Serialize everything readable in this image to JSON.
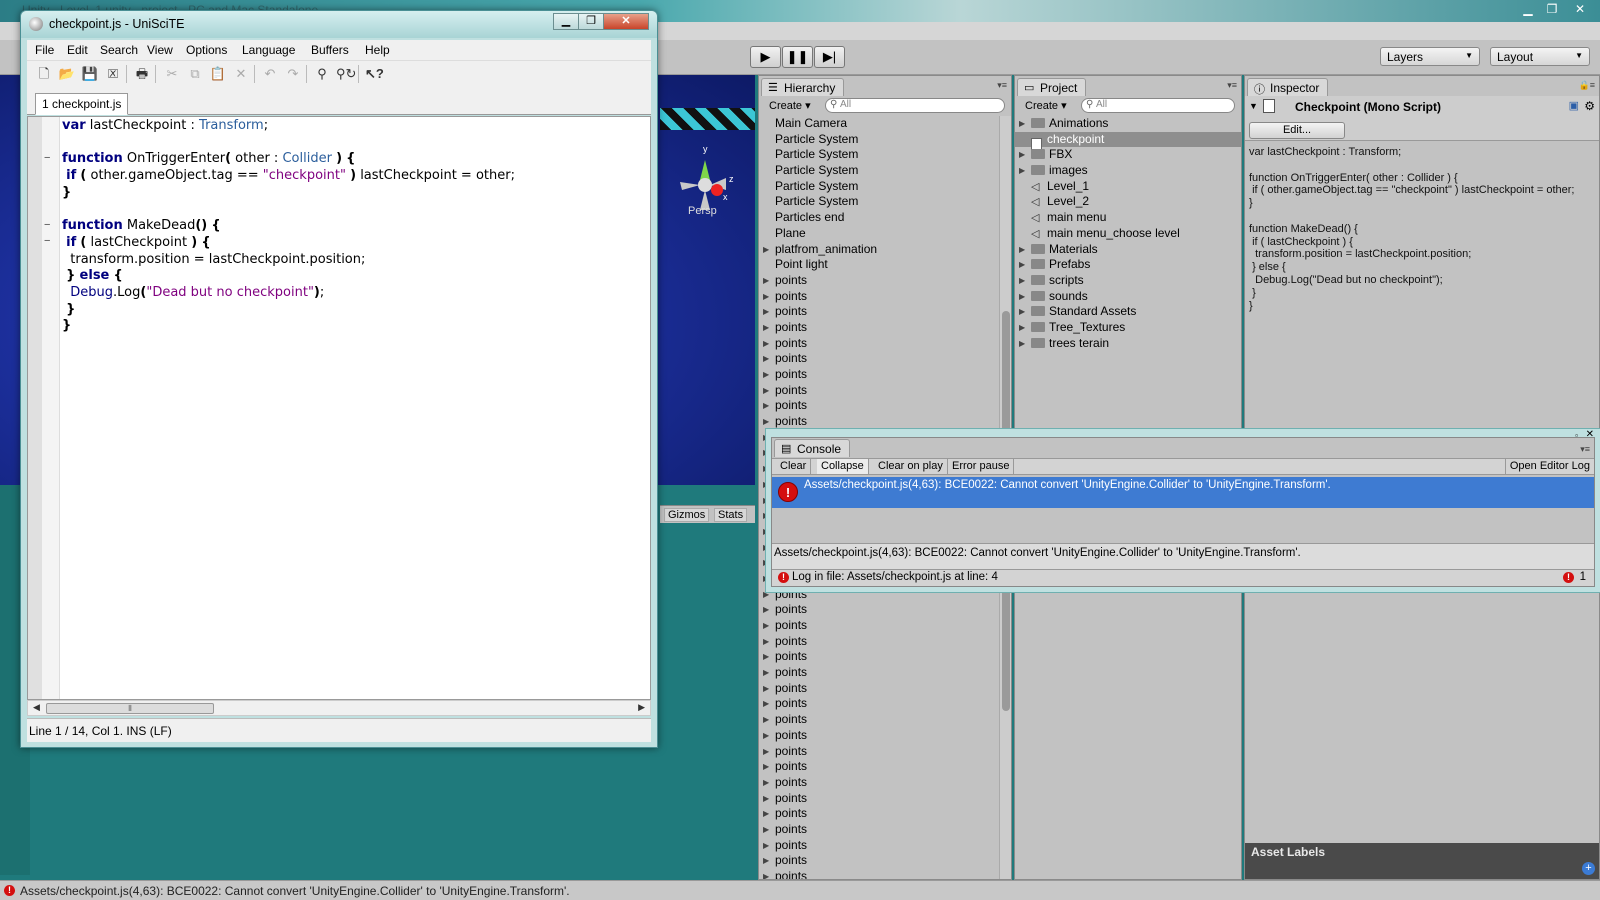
{
  "unity": {
    "title": "Unity - Level_1.unity - project - PC and Mac Standalone",
    "layers_label": "Layers",
    "layout_label": "Layout",
    "persp_label": "Persp",
    "gizmos_label": "Gizmos",
    "stats_label": "Stats",
    "status_message": "Assets/checkpoint.js(4,63): BCE0022: Cannot convert 'UnityEngine.Collider' to 'UnityEngine.Transform'."
  },
  "hierarchy": {
    "tab_label": "Hierarchy",
    "create_label": "Create",
    "search_placeholder": "All",
    "items": [
      {
        "label": "Main Camera",
        "expandable": false
      },
      {
        "label": "Particle System",
        "expandable": false
      },
      {
        "label": "Particle System",
        "expandable": false
      },
      {
        "label": "Particle System",
        "expandable": false
      },
      {
        "label": "Particle System",
        "expandable": false
      },
      {
        "label": "Particle System",
        "expandable": false
      },
      {
        "label": "Particles end",
        "expandable": false
      },
      {
        "label": "Plane",
        "expandable": false
      },
      {
        "label": "platfrom_animation",
        "expandable": true
      },
      {
        "label": "Point light",
        "expandable": false
      },
      {
        "label": "points",
        "expandable": true
      },
      {
        "label": "points",
        "expandable": true
      },
      {
        "label": "points",
        "expandable": true
      },
      {
        "label": "points",
        "expandable": true
      },
      {
        "label": "points",
        "expandable": true
      },
      {
        "label": "points",
        "expandable": true
      },
      {
        "label": "points",
        "expandable": true
      },
      {
        "label": "points",
        "expandable": true
      },
      {
        "label": "points",
        "expandable": true
      },
      {
        "label": "points",
        "expandable": true
      },
      {
        "label": "points",
        "expandable": true
      },
      {
        "label": "points",
        "expandable": true
      },
      {
        "label": "points",
        "expandable": true
      },
      {
        "label": "points",
        "expandable": true
      },
      {
        "label": "points",
        "expandable": true
      },
      {
        "label": "points",
        "expandable": true
      },
      {
        "label": "points",
        "expandable": true
      },
      {
        "label": "points",
        "expandable": true
      },
      {
        "label": "points",
        "expandable": true
      },
      {
        "label": "points",
        "expandable": true
      },
      {
        "label": "points",
        "expandable": true
      },
      {
        "label": "points",
        "expandable": true
      },
      {
        "label": "points",
        "expandable": true
      },
      {
        "label": "points",
        "expandable": true
      },
      {
        "label": "points",
        "expandable": true
      },
      {
        "label": "points",
        "expandable": true
      },
      {
        "label": "points",
        "expandable": true
      },
      {
        "label": "points",
        "expandable": true
      },
      {
        "label": "points",
        "expandable": true
      },
      {
        "label": "points",
        "expandable": true
      },
      {
        "label": "points",
        "expandable": true
      },
      {
        "label": "points",
        "expandable": true
      },
      {
        "label": "points",
        "expandable": true
      },
      {
        "label": "points",
        "expandable": true
      },
      {
        "label": "points",
        "expandable": true
      },
      {
        "label": "points",
        "expandable": true
      },
      {
        "label": "points",
        "expandable": true
      },
      {
        "label": "points",
        "expandable": true
      },
      {
        "label": "points",
        "expandable": true
      }
    ]
  },
  "project": {
    "tab_label": "Project",
    "create_label": "Create",
    "search_placeholder": "All",
    "items": [
      {
        "label": "Animations",
        "kind": "folder",
        "expandable": true
      },
      {
        "label": "checkpoint",
        "kind": "script",
        "expandable": false,
        "selected": true
      },
      {
        "label": "FBX",
        "kind": "folder",
        "expandable": true
      },
      {
        "label": "images",
        "kind": "folder",
        "expandable": true
      },
      {
        "label": "Level_1",
        "kind": "scene",
        "expandable": false
      },
      {
        "label": "Level_2",
        "kind": "scene",
        "expandable": false
      },
      {
        "label": "main menu",
        "kind": "scene",
        "expandable": false
      },
      {
        "label": "main menu_choose level",
        "kind": "scene",
        "expandable": false
      },
      {
        "label": "Materials",
        "kind": "folder",
        "expandable": true
      },
      {
        "label": "Prefabs",
        "kind": "folder",
        "expandable": true
      },
      {
        "label": "scripts",
        "kind": "folder",
        "expandable": true
      },
      {
        "label": "sounds",
        "kind": "folder",
        "expandable": true
      },
      {
        "label": "Standard Assets",
        "kind": "folder",
        "expandable": true
      },
      {
        "label": "Tree_Textures",
        "kind": "folder",
        "expandable": true
      },
      {
        "label": "trees terain",
        "kind": "folder",
        "expandable": true
      }
    ]
  },
  "inspector": {
    "tab_label": "Inspector",
    "title": "Checkpoint (Mono Script)",
    "edit_label": "Edit...",
    "code": "var lastCheckpoint : Transform;\n\nfunction OnTriggerEnter( other : Collider ) {\n if ( other.gameObject.tag == \"checkpoint\" ) lastCheckpoint = other;\n}\n\nfunction MakeDead() {\n if ( lastCheckpoint ) {\n  transform.position = lastCheckpoint.position;\n } else {\n  Debug.Log(\"Dead but no checkpoint\");\n }\n}",
    "asset_labels": "Asset Labels"
  },
  "console": {
    "tab_label": "Console",
    "buttons": [
      "Clear",
      "Collapse",
      "Clear on play",
      "Error pause"
    ],
    "open_log_label": "Open Editor Log",
    "entry": "Assets/checkpoint.js(4,63): BCE0022: Cannot convert 'UnityEngine.Collider' to 'UnityEngine.Transform'.",
    "detail": "Assets/checkpoint.js(4,63): BCE0022: Cannot convert 'UnityEngine.Collider' to 'UnityEngine.Transform'.",
    "status": "Log in file: Assets/checkpoint.js at line: 4",
    "error_count": "1"
  },
  "scite": {
    "title": "checkpoint.js - UniSciTE",
    "menu": [
      "File",
      "Edit",
      "Search",
      "View",
      "Options",
      "Language",
      "Buffers",
      "Help"
    ],
    "tab_label": "1 checkpoint.js",
    "status": "Line 1 / 14, Col 1. INS (LF)",
    "code_lines": [
      "var lastCheckpoint : Transform;",
      "",
      "function OnTriggerEnter( other : Collider ) {",
      " if ( other.gameObject.tag == \"checkpoint\" ) lastCheckpoint = other;",
      "}",
      "",
      "function MakeDead() {",
      " if ( lastCheckpoint ) {",
      "  transform.position = lastCheckpoint.position;",
      " } else {",
      "  Debug.Log(\"Dead but no checkpoint\");",
      " }",
      "}"
    ]
  }
}
